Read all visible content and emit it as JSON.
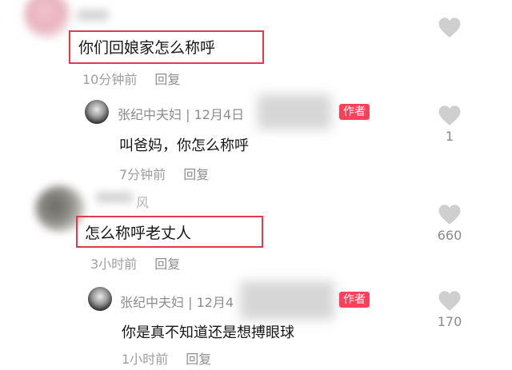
{
  "icons": {
    "like": "heart-icon"
  },
  "colors": {
    "highlight_box": "#e4394a",
    "author_badge": "#fd3f5a",
    "meta_text": "#9d9d9d",
    "heart": "#cfcfcf"
  },
  "comments": [
    {
      "text": "你们回娘家怎么称呼",
      "time": "10分钟前",
      "reply_label": "回复",
      "likes": "",
      "highlighted": true
    },
    {
      "text": "怎么称呼老丈人",
      "time": "3小时前",
      "reply_label": "回复",
      "likes": "660",
      "highlighted": true
    }
  ],
  "replies": [
    {
      "name_line": "张纪中夫妇 | 12月4日",
      "badge": "作者",
      "text": "叫爸妈，你怎么称呼",
      "time": "7分钟前",
      "reply_label": "回复",
      "likes": "1"
    },
    {
      "name_line": "张纪中夫妇 | 12月4",
      "badge": "作者",
      "text": "你是真不知道还是想搏眼球",
      "time": "1小时前",
      "reply_label": "回复",
      "likes": "170"
    }
  ],
  "blurred_username_fragment": "风"
}
